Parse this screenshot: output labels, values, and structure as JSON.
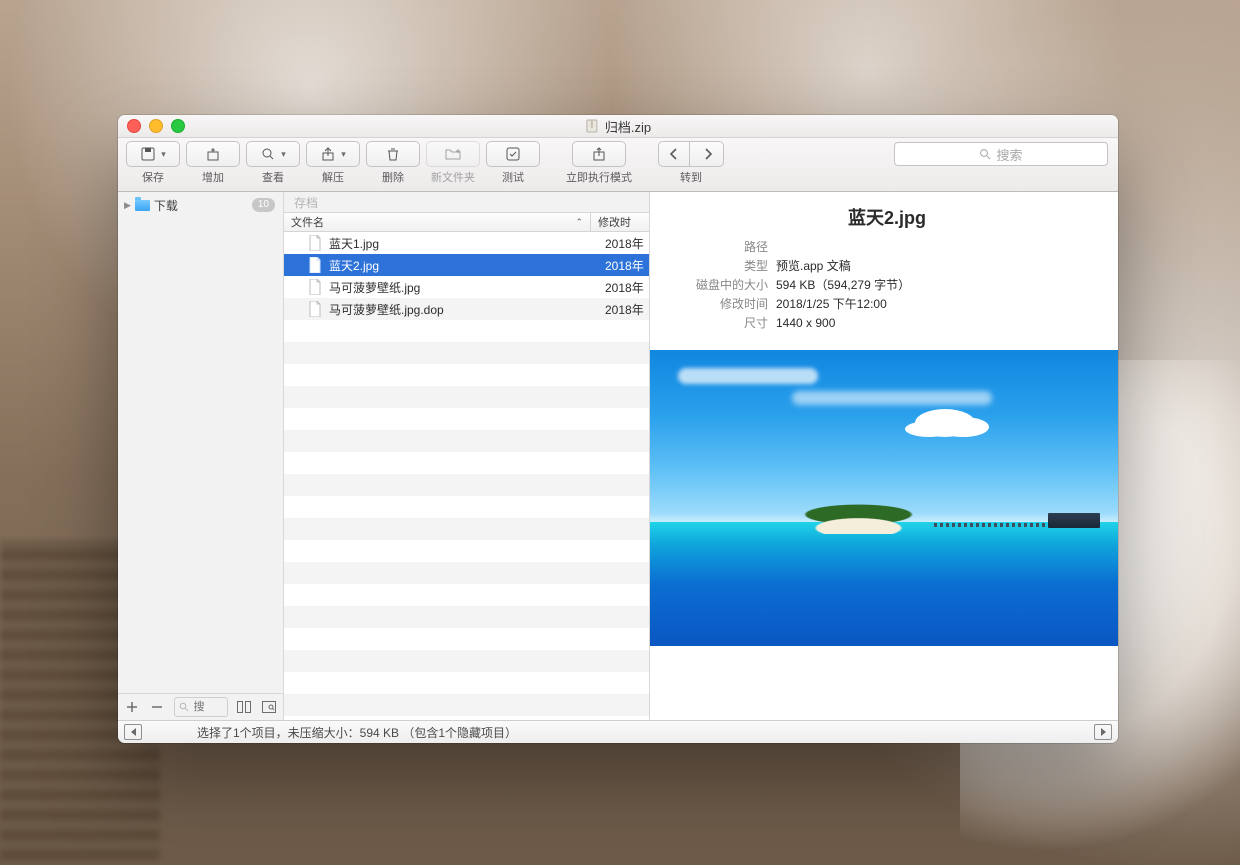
{
  "window": {
    "title": "归档.zip"
  },
  "toolbar": {
    "save": {
      "label": "保存"
    },
    "add": {
      "label": "增加"
    },
    "view": {
      "label": "查看"
    },
    "extract": {
      "label": "解压"
    },
    "delete": {
      "label": "删除"
    },
    "newfolder": {
      "label": "新文件夹"
    },
    "test": {
      "label": "测试"
    },
    "runmode": {
      "label": "立即执行模式"
    },
    "goto": {
      "label": "转到"
    },
    "search_placeholder": "搜索"
  },
  "sidebar": {
    "items": [
      {
        "name": "下载",
        "badge": "10"
      }
    ],
    "footer_search_placeholder": "搜"
  },
  "middle": {
    "tab_label": "存档",
    "columns": {
      "name": "文件名",
      "modified": "修改时"
    },
    "files": [
      {
        "name": "蓝天1.jpg",
        "date": "2018年",
        "selected": false
      },
      {
        "name": "蓝天2.jpg",
        "date": "2018年",
        "selected": true
      },
      {
        "name": "马可菠萝壁纸.jpg",
        "date": "2018年",
        "selected": false
      },
      {
        "name": "马可菠萝壁纸.jpg.dop",
        "date": "2018年",
        "selected": false
      }
    ]
  },
  "detail": {
    "title": "蓝天2.jpg",
    "rows": {
      "path": {
        "label": "路径",
        "value": ""
      },
      "type": {
        "label": "类型",
        "value": "预览.app 文稿"
      },
      "size": {
        "label": "磁盘中的大小",
        "value": "594 KB（594,279 字节）"
      },
      "modified": {
        "label": "修改时间",
        "value": "2018/1/25 下午12:00"
      },
      "dims": {
        "label": "尺寸",
        "value": "1440 x 900"
      }
    }
  },
  "status": {
    "text": "选择了1个项目，未压缩大小：594 KB （包含1个隐藏项目）"
  }
}
